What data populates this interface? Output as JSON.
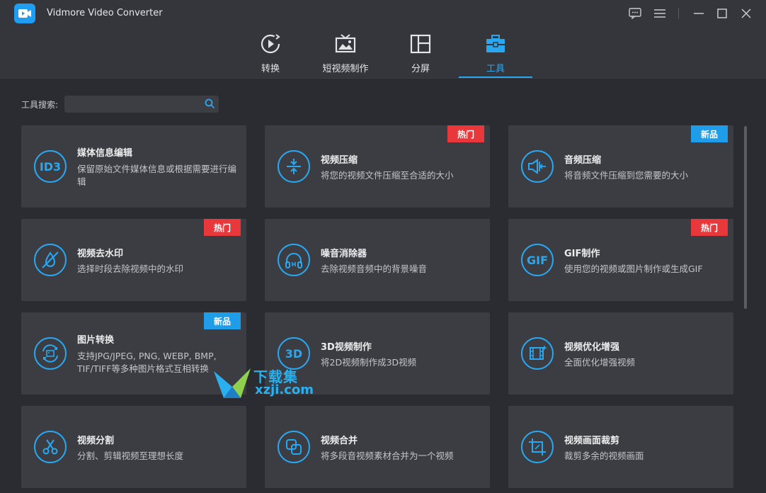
{
  "app": {
    "title": "Vidmore Video Converter"
  },
  "tabs": [
    {
      "label": "转换",
      "icon": "convert-icon"
    },
    {
      "label": "短视频制作",
      "icon": "tv-icon"
    },
    {
      "label": "分屏",
      "icon": "split-screen-icon"
    },
    {
      "label": "工具",
      "icon": "toolbox-icon",
      "active": true
    }
  ],
  "search": {
    "label": "工具搜索:",
    "placeholder": "",
    "value": ""
  },
  "tools": [
    {
      "title": "媒体信息编辑",
      "desc": "保留原始文件媒体信息或根据需要进行编辑",
      "icon": "id3-icon",
      "icon_text": "ID3",
      "badge": ""
    },
    {
      "title": "视频压缩",
      "desc": "将您的视频文件压缩至合适的大小",
      "icon": "compress-icon",
      "badge": "热门"
    },
    {
      "title": "音频压缩",
      "desc": "将音频文件压缩到您需要的大小",
      "icon": "audio-compress-icon",
      "badge": "新品"
    },
    {
      "title": "视频去水印",
      "desc": "选择时段去除视频中的水印",
      "icon": "remove-watermark-icon",
      "badge": "热门"
    },
    {
      "title": "噪音消除器",
      "desc": "去除视频音频中的背景噪音",
      "icon": "headphones-icon",
      "badge": ""
    },
    {
      "title": "GIF制作",
      "desc": "使用您的视频或图片制作或生成GIF",
      "icon": "gif-icon",
      "icon_text": "GIF",
      "badge": "热门"
    },
    {
      "title": "图片转换",
      "desc": "支持JPG/JPEG, PNG, WEBP, BMP, TIF/TIFF等多种图片格式互相转换",
      "icon": "image-convert-icon",
      "badge": "新品"
    },
    {
      "title": "3D视频制作",
      "desc": "将2D视频制作成3D视频",
      "icon": "3d-icon",
      "icon_text": "3D",
      "badge": ""
    },
    {
      "title": "视频优化增强",
      "desc": "全面优化增强视频",
      "icon": "enhance-icon",
      "badge": ""
    },
    {
      "title": "视频分割",
      "desc": "分割、剪辑视频至理想长度",
      "icon": "scissors-icon",
      "badge": ""
    },
    {
      "title": "视频合并",
      "desc": "将多段音视频素材合并为一个视频",
      "icon": "merge-icon",
      "badge": ""
    },
    {
      "title": "视频画面裁剪",
      "desc": "裁剪多余的视频画面",
      "icon": "crop-icon",
      "badge": ""
    }
  ],
  "watermark": {
    "line1": "下载集",
    "line2": "xzji.com"
  },
  "colors": {
    "accent": "#29a8f2",
    "hot": "#e8383b",
    "new": "#1f9de8",
    "card_bg": "#3c3d43",
    "page_bg": "#2b2c31"
  }
}
